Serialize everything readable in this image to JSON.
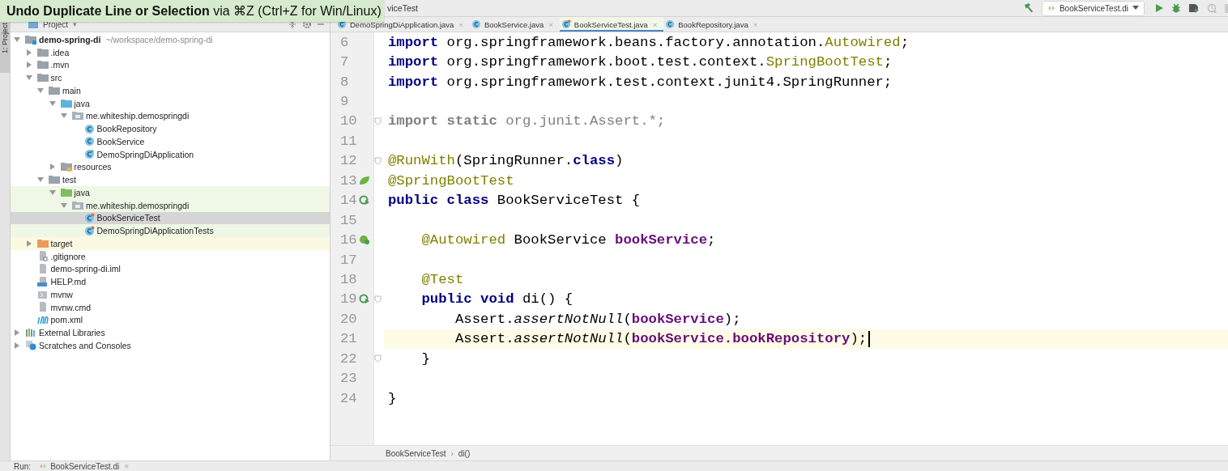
{
  "tooltip": {
    "text": "**Undo Duplicate Line or Selection** via ⌘Z (Ctrl+Z for Win/Linux)"
  },
  "navbar": {
    "crumb": "viceTest",
    "run_config": "BookServiceTest.di"
  },
  "side_strip": {
    "label": "1: Project"
  },
  "project_panel": {
    "title": "Project",
    "arrow": "▾"
  },
  "tree": [
    {
      "label": "demo-spring-di",
      "hint": "~/workspace/demo-spring-di",
      "kind": "module",
      "expanded": true,
      "selected": false,
      "children": [
        {
          "label": ".idea",
          "kind": "folder",
          "expanded": false,
          "selected": false
        },
        {
          "label": ".mvn",
          "kind": "folder",
          "expanded": false,
          "selected": false
        },
        {
          "label": "src",
          "kind": "folder",
          "expanded": true,
          "selected": false,
          "children": [
            {
              "label": "main",
              "kind": "folder",
              "expanded": true,
              "selected": false,
              "children": [
                {
                  "label": "java",
                  "kind": "src-root",
                  "expanded": true,
                  "selected": false,
                  "children": [
                    {
                      "label": "me.whiteship.demospringdi",
                      "kind": "package",
                      "expanded": true,
                      "selected": false,
                      "children": [
                        {
                          "label": "BookRepository",
                          "kind": "class",
                          "selected": false
                        },
                        {
                          "label": "BookService",
                          "kind": "class",
                          "selected": false
                        },
                        {
                          "label": "DemoSpringDiApplication",
                          "kind": "spring-class",
                          "selected": false
                        }
                      ]
                    }
                  ]
                },
                {
                  "label": "resources",
                  "kind": "resources",
                  "expanded": false,
                  "selected": false
                }
              ]
            },
            {
              "label": "test",
              "kind": "folder",
              "expanded": true,
              "selected": false,
              "children": [
                {
                  "label": "java",
                  "kind": "test-root",
                  "test_source": true,
                  "expanded": true,
                  "selected": false,
                  "children": [
                    {
                      "label": "me.whiteship.demospringdi",
                      "kind": "package",
                      "test_source": true,
                      "expanded": true,
                      "selected": false,
                      "children": [
                        {
                          "label": "BookServiceTest",
                          "kind": "test-class",
                          "test_source": true,
                          "selected": true
                        },
                        {
                          "label": "DemoSpringDiApplicationTests",
                          "kind": "test-class",
                          "test_source": true,
                          "selected": false
                        }
                      ]
                    }
                  ]
                }
              ]
            }
          ]
        },
        {
          "label": "target",
          "kind": "excluded",
          "excluded": true,
          "expanded": false,
          "selected": false
        },
        {
          "label": ".gitignore",
          "kind": "ignore-file",
          "selected": false
        },
        {
          "label": "demo-spring-di.iml",
          "kind": "file",
          "selected": false
        },
        {
          "label": "HELP.md",
          "kind": "md",
          "selected": false
        },
        {
          "label": "mvnw",
          "kind": "script",
          "selected": false
        },
        {
          "label": "mvnw.cmd",
          "kind": "file",
          "selected": false
        },
        {
          "label": "pom.xml",
          "kind": "maven",
          "selected": false
        }
      ]
    },
    {
      "label": "External Libraries",
      "kind": "libs",
      "expanded": false,
      "selected": false
    },
    {
      "label": "Scratches and Consoles",
      "kind": "scratch",
      "expanded": false,
      "selected": false
    }
  ],
  "editor_tabs": [
    {
      "label": "DemoSpringDiApplication.java",
      "kind": "spring-class",
      "selected": false,
      "close": "×"
    },
    {
      "label": "BookService.java",
      "kind": "class",
      "selected": false,
      "close": "×"
    },
    {
      "label": "BookServiceTest.java",
      "kind": "test-class",
      "selected": true,
      "close": "×"
    },
    {
      "label": "BookRepository.java",
      "kind": "class",
      "selected": false,
      "close": "×"
    }
  ],
  "code": [
    {
      "number": "6",
      "fold": false,
      "current": false,
      "tokens": [
        {
          "t": "import",
          "kind": "kw"
        },
        {
          "t": " org.springframework.beans.factory.annotation.",
          "kind": "plain"
        },
        {
          "t": "Autowired",
          "kind": "ann"
        },
        {
          "t": ";",
          "kind": "plain"
        }
      ]
    },
    {
      "number": "7",
      "fold": false,
      "current": false,
      "tokens": [
        {
          "t": "import",
          "kind": "kw"
        },
        {
          "t": " org.springframework.boot.test.context.",
          "kind": "plain"
        },
        {
          "t": "SpringBootTest",
          "kind": "ann"
        },
        {
          "t": ";",
          "kind": "plain"
        }
      ]
    },
    {
      "number": "8",
      "fold": false,
      "current": false,
      "tokens": [
        {
          "t": "import",
          "kind": "kw"
        },
        {
          "t": " org.springframework.test.context.junit4.SpringRunner;",
          "kind": "plain"
        }
      ]
    },
    {
      "number": "9",
      "fold": false,
      "current": false
    },
    {
      "number": "10",
      "fold": true,
      "current": false,
      "tokens": [
        {
          "t": "import static",
          "kind": "unused-kw"
        },
        {
          "t": " org.junit.Assert.*;",
          "kind": "unused"
        }
      ]
    },
    {
      "number": "11",
      "fold": false,
      "current": false
    },
    {
      "number": "12",
      "fold": true,
      "current": false,
      "tokens": [
        {
          "t": "@RunWith",
          "kind": "ann"
        },
        {
          "t": "(SpringRunner.",
          "kind": "plain"
        },
        {
          "t": "class",
          "kind": "kw"
        },
        {
          "t": ")",
          "kind": "plain"
        }
      ]
    },
    {
      "number": "13",
      "fold": false,
      "current": false,
      "marker": {
        "kind": "leaf"
      },
      "tokens": [
        {
          "t": "@SpringBootTest",
          "kind": "ann"
        }
      ]
    },
    {
      "number": "14",
      "fold": false,
      "current": false,
      "marker": {
        "kind": "run"
      },
      "tokens": [
        {
          "t": "public class",
          "kind": "kw"
        },
        {
          "t": " BookServiceTest {",
          "kind": "plain"
        }
      ]
    },
    {
      "number": "15",
      "fold": false,
      "current": false
    },
    {
      "number": "16",
      "fold": false,
      "current": false,
      "marker": {
        "kind": "bean"
      },
      "tokens": [
        {
          "t": "    @Autowired",
          "kind": "ann"
        },
        {
          "t": " BookService ",
          "kind": "plain"
        },
        {
          "t": "bookService",
          "kind": "field"
        },
        {
          "t": ";",
          "kind": "plain"
        }
      ]
    },
    {
      "number": "17",
      "fold": false,
      "current": false
    },
    {
      "number": "18",
      "fold": false,
      "current": false,
      "tokens": [
        {
          "t": "    @Test",
          "kind": "ann"
        }
      ]
    },
    {
      "number": "19",
      "fold": true,
      "current": false,
      "marker": {
        "kind": "run"
      },
      "tokens": [
        {
          "t": "    public void",
          "kind": "kw"
        },
        {
          "t": " di() {",
          "kind": "plain"
        }
      ]
    },
    {
      "number": "20",
      "fold": false,
      "current": false,
      "tokens": [
        {
          "t": "        Assert.",
          "kind": "plain"
        },
        {
          "t": "assertNotNull",
          "kind": "static"
        },
        {
          "t": "(",
          "kind": "plain"
        },
        {
          "t": "bookService",
          "kind": "field"
        },
        {
          "t": ");",
          "kind": "plain"
        }
      ]
    },
    {
      "number": "21",
      "fold": false,
      "current": true,
      "tokens": [
        {
          "t": "        Assert.",
          "kind": "plain"
        },
        {
          "t": "assertNotNull",
          "kind": "static"
        },
        {
          "t": "(",
          "kind": "plain"
        },
        {
          "t": "bookService.bookRepository",
          "kind": "field"
        },
        {
          "t": ");",
          "kind": "plain"
        }
      ]
    },
    {
      "number": "22",
      "fold": true,
      "current": false,
      "tokens": [
        {
          "t": "    }",
          "kind": "plain"
        }
      ]
    },
    {
      "number": "23",
      "fold": false,
      "current": false
    },
    {
      "number": "24",
      "fold": false,
      "current": false,
      "tokens": [
        {
          "t": "}",
          "kind": "plain"
        }
      ]
    }
  ],
  "breadcrumbs": {
    "items": [
      "BookServiceTest",
      "di()"
    ],
    "separator": "›"
  },
  "run_bar": {
    "label": "Run:",
    "tab": "BookServiceTest.di",
    "close": "×"
  }
}
